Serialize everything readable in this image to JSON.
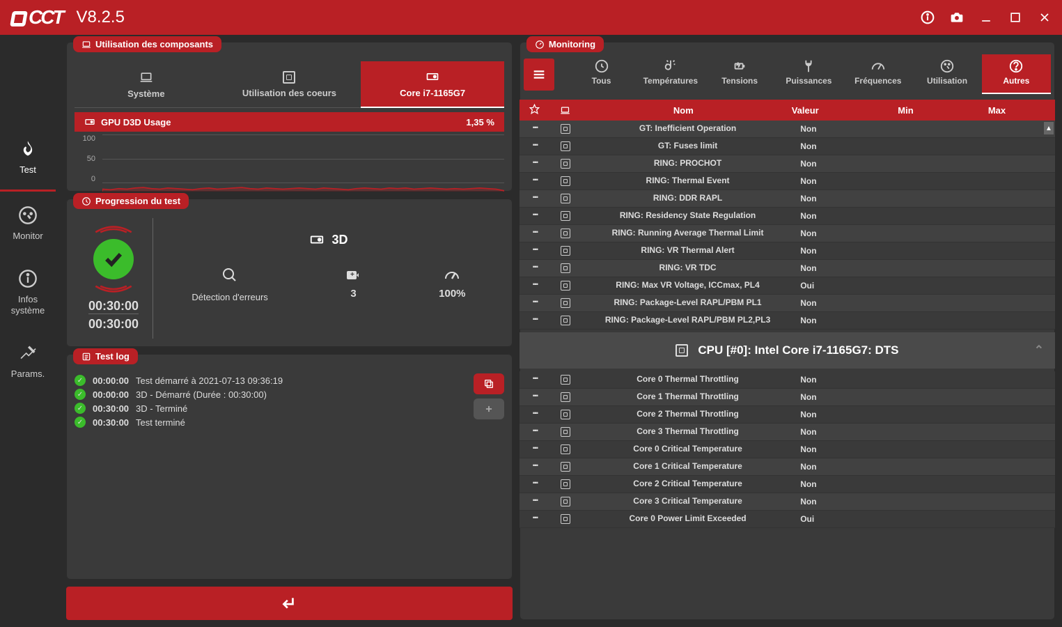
{
  "app": {
    "name": "OCCT",
    "version": "V8.2.5"
  },
  "sidebar": {
    "items": [
      {
        "label": "Test"
      },
      {
        "label": "Monitor"
      },
      {
        "label": "Infos système"
      },
      {
        "label": "Params."
      }
    ]
  },
  "components_panel": {
    "title": "Utilisation des composants",
    "tabs": [
      {
        "label": "Système"
      },
      {
        "label": "Utilisation des coeurs"
      },
      {
        "label": "Core i7-1165G7"
      }
    ],
    "gpu_row_label": "GPU D3D Usage",
    "gpu_row_value": "1,35 %"
  },
  "chart_data": {
    "type": "line",
    "title": "GPU D3D Usage",
    "ylabel": "%",
    "ylim": [
      0,
      100
    ],
    "yticks": [
      0,
      50,
      100
    ],
    "x": [
      0,
      1,
      2,
      3,
      4,
      5,
      6,
      7,
      8,
      9,
      10,
      11,
      12,
      13,
      14,
      15,
      16,
      17,
      18,
      19,
      20,
      21,
      22,
      23,
      24,
      25,
      26,
      27,
      28,
      29,
      30,
      31,
      32,
      33,
      34,
      35,
      36,
      37,
      38,
      39,
      40,
      41,
      42,
      43,
      44,
      45,
      46,
      47,
      48,
      49
    ],
    "values": [
      4,
      3,
      5,
      4,
      6,
      7,
      5,
      4,
      6,
      5,
      4,
      3,
      5,
      6,
      4,
      5,
      6,
      7,
      5,
      4,
      6,
      5,
      4,
      5,
      6,
      5,
      4,
      6,
      5,
      4,
      3,
      5,
      6,
      5,
      4,
      6,
      5,
      6,
      4,
      5,
      6,
      5,
      4,
      5,
      4,
      5,
      6,
      5,
      4,
      1.35
    ]
  },
  "progression": {
    "title": "Progression du test",
    "test_name": "3D",
    "elapsed": "00:30:00",
    "total": "00:30:00",
    "stats": [
      {
        "label": "Détection d'erreurs",
        "value": ""
      },
      {
        "label": "",
        "value": "3"
      },
      {
        "label": "",
        "value": "100%"
      }
    ]
  },
  "testlog": {
    "title": "Test log",
    "lines": [
      {
        "time": "00:00:00",
        "text": "Test démarré à 2021-07-13 09:36:19"
      },
      {
        "time": "00:00:00",
        "text": "3D  -  Démarré (Durée : 00:30:00)"
      },
      {
        "time": "00:30:00",
        "text": "3D  -  Terminé"
      },
      {
        "time": "00:30:00",
        "text": "Test terminé"
      }
    ]
  },
  "monitoring": {
    "title": "Monitoring",
    "categories": [
      {
        "label": "Tous"
      },
      {
        "label": "Températures"
      },
      {
        "label": "Tensions"
      },
      {
        "label": "Puissances"
      },
      {
        "label": "Fréquences"
      },
      {
        "label": "Utilisation"
      },
      {
        "label": "Autres"
      }
    ],
    "headers": {
      "name": "Nom",
      "value": "Valeur",
      "min": "Min",
      "max": "Max"
    },
    "rows1": [
      {
        "name": "GT: Inefficient Operation",
        "value": "Non"
      },
      {
        "name": "GT: Fuses limit",
        "value": "Non"
      },
      {
        "name": "RING: PROCHOT",
        "value": "Non"
      },
      {
        "name": "RING: Thermal Event",
        "value": "Non"
      },
      {
        "name": "RING: DDR RAPL",
        "value": "Non"
      },
      {
        "name": "RING: Residency State Regulation",
        "value": "Non"
      },
      {
        "name": "RING: Running Average Thermal Limit",
        "value": "Non"
      },
      {
        "name": "RING: VR Thermal Alert",
        "value": "Non"
      },
      {
        "name": "RING: VR TDC",
        "value": "Non"
      },
      {
        "name": "RING: Max VR Voltage, ICCmax, PL4",
        "value": "Oui"
      },
      {
        "name": "RING: Package-Level RAPL/PBM PL1",
        "value": "Non"
      },
      {
        "name": "RING: Package-Level RAPL/PBM PL2,PL3",
        "value": "Non"
      }
    ],
    "group": "CPU [#0]: Intel Core i7-1165G7: DTS",
    "rows2": [
      {
        "name": "Core 0 Thermal Throttling",
        "value": "Non"
      },
      {
        "name": "Core 1 Thermal Throttling",
        "value": "Non"
      },
      {
        "name": "Core 2 Thermal Throttling",
        "value": "Non"
      },
      {
        "name": "Core 3 Thermal Throttling",
        "value": "Non"
      },
      {
        "name": "Core 0 Critical Temperature",
        "value": "Non"
      },
      {
        "name": "Core 1 Critical Temperature",
        "value": "Non"
      },
      {
        "name": "Core 2 Critical Temperature",
        "value": "Non"
      },
      {
        "name": "Core 3 Critical Temperature",
        "value": "Non"
      },
      {
        "name": "Core 0 Power Limit Exceeded",
        "value": "Oui"
      }
    ]
  }
}
